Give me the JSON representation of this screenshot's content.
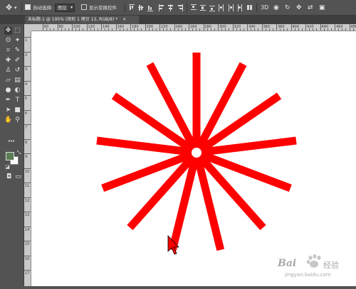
{
  "options_bar": {
    "move_icon": "move-icon",
    "auto_select_checked": true,
    "auto_select_label": "自动选择:",
    "auto_select_target": "图层",
    "show_transform_checked": false,
    "show_transform_label": "显示变换控件"
  },
  "document_tab": {
    "title": "未标题-1 @ 195% (矩形 1 拷贝 13, RGB/8) *",
    "close": "×"
  },
  "ruler_top": [
    "60",
    "80",
    "100",
    "120",
    "140",
    "160",
    "180",
    "200",
    "220",
    "240",
    "260",
    "280",
    "300",
    "320",
    "340",
    "360",
    "380",
    "400",
    "420",
    "440",
    "460",
    "480"
  ],
  "ruler_left": [
    "1",
    "2",
    "3",
    "4",
    "5",
    "6",
    "7",
    "8",
    "9",
    "10",
    "11",
    "12",
    "13",
    "14",
    "15",
    "16",
    "17"
  ],
  "tools": [
    "move-icon",
    "marquee-icon",
    "lasso-icon",
    "magic-wand-icon",
    "crop-icon",
    "eyedropper-icon",
    "healing-brush-icon",
    "brush-icon",
    "clone-stamp-icon",
    "history-brush-icon",
    "eraser-icon",
    "gradient-icon",
    "blur-icon",
    "dodge-icon",
    "pen-icon",
    "type-icon",
    "path-select-icon",
    "rectangle-icon",
    "hand-icon",
    "zoom-icon"
  ],
  "colors": {
    "foreground": "#5a7d52",
    "background": "#ffffff",
    "shape": "#ff0000"
  },
  "watermark": {
    "brand": "Bai",
    "brand_suffix": "经验",
    "url": "jingyan.baidu.com"
  }
}
